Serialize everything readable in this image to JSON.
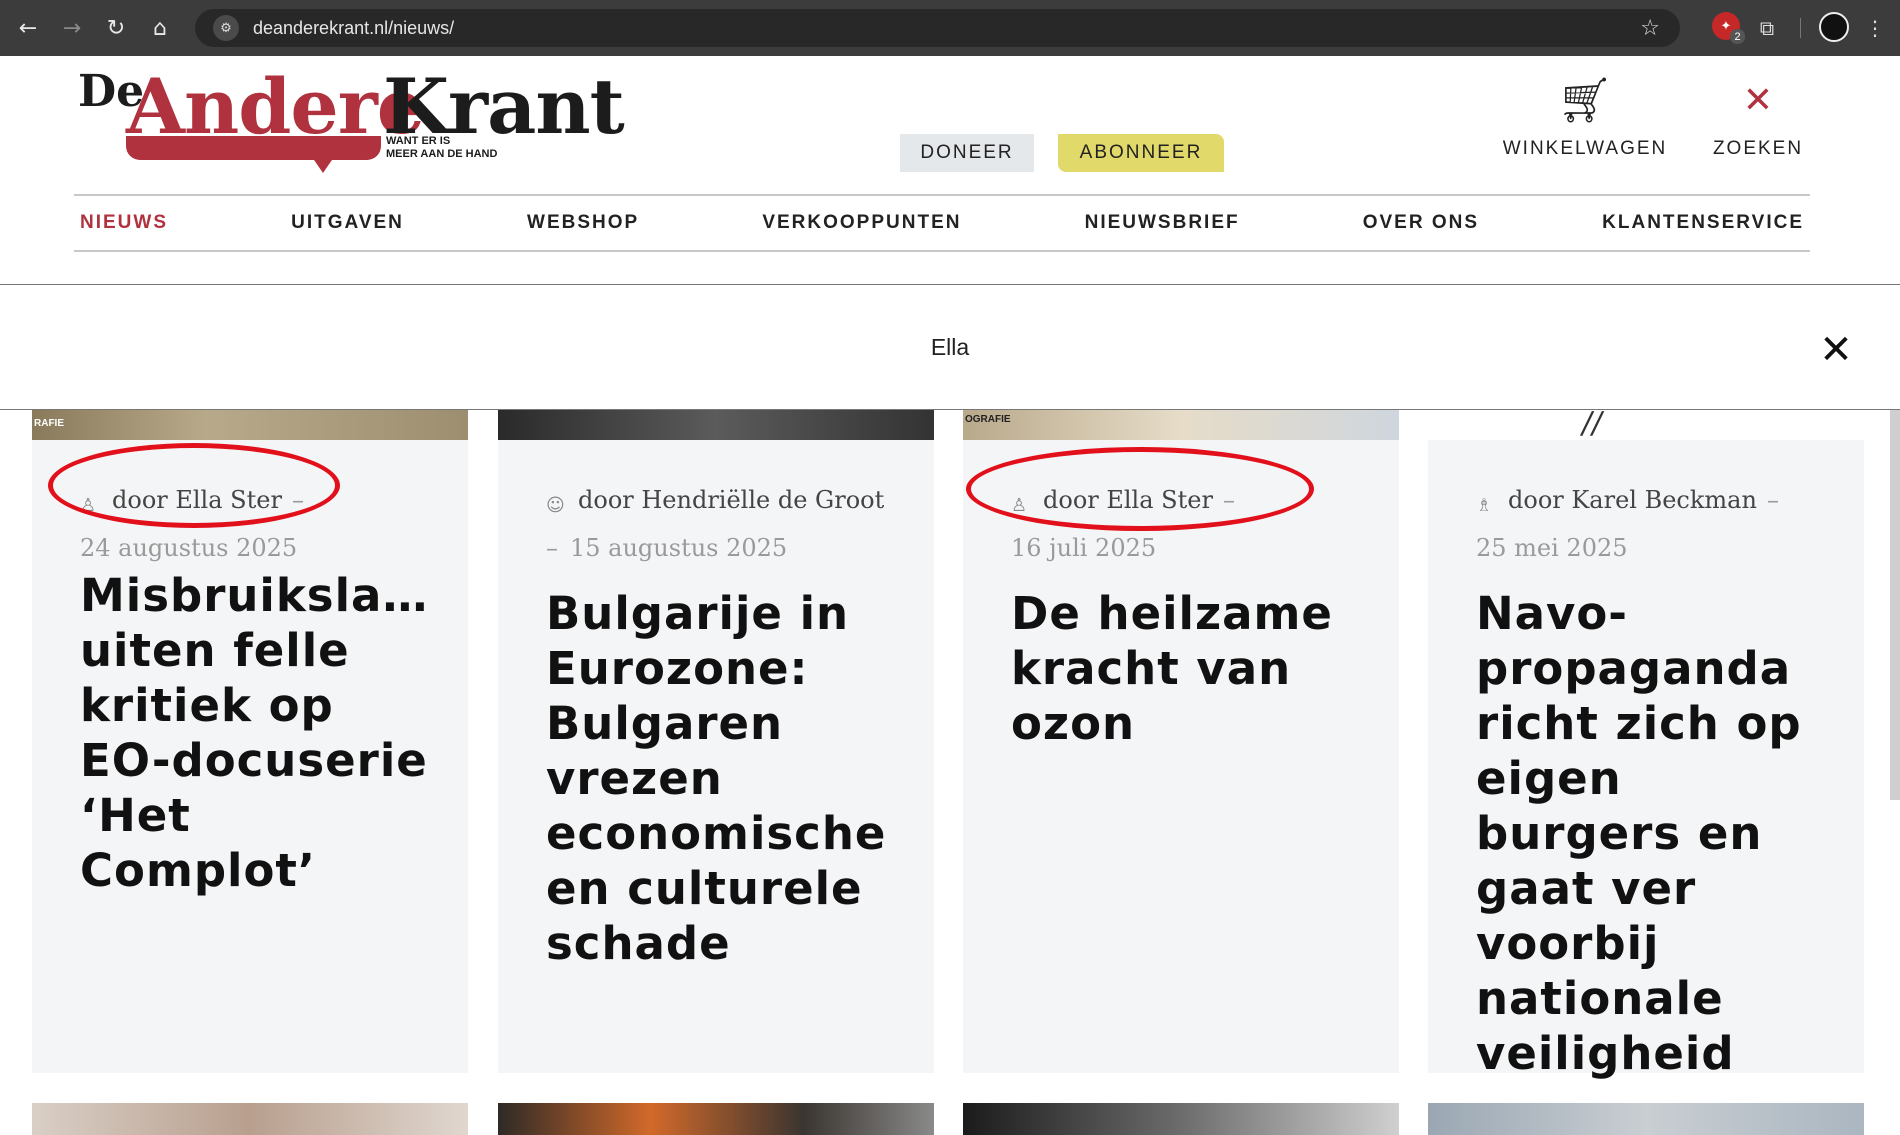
{
  "browser": {
    "back_icon": "back-arrow-icon",
    "forward_icon": "forward-arrow-icon",
    "reload_icon": "reload-icon",
    "home_icon": "home-icon",
    "url": "deanderekrant.nl/nieuws/",
    "bookmark_icon": "star-icon",
    "extension_badge_count": "2"
  },
  "header": {
    "logo": {
      "de": "De",
      "andere": "Andere",
      "krant": "Krant",
      "tagline_line1": "WANT ER IS",
      "tagline_line2": "MEER AAN DE HAND"
    },
    "doneer_label": "DONEER",
    "abonneer_label": "ABONNEER",
    "cart_label": "WINKELWAGEN",
    "search_label": "ZOEKEN"
  },
  "nav": {
    "items": [
      {
        "label": "NIEUWS",
        "active": true
      },
      {
        "label": "UITGAVEN"
      },
      {
        "label": "WEBSHOP"
      },
      {
        "label": "VERKOOPPUNTEN"
      },
      {
        "label": "NIEUWSBRIEF"
      },
      {
        "label": "OVER ONS"
      },
      {
        "label": "KLANTENSERVICE"
      }
    ]
  },
  "search": {
    "value": "Ella"
  },
  "articles": [
    {
      "author": "door Ella Ster",
      "date": "24 augustus 2025",
      "title": "Misbruiksla… uiten felle kritiek op EO-docuserie ‘Het Complot’",
      "highlighted": true
    },
    {
      "author": "door Hendriëlle de Groot",
      "date": "15 augustus 2025",
      "title": "Bulgarije in Eurozone: Bulgaren vrezen economische en culturele schade",
      "highlighted": false
    },
    {
      "author": "door Ella Ster",
      "date": "16 juli 2025",
      "title": "De heilzame kracht van ozon",
      "highlighted": true
    },
    {
      "author": "door Karel Beckman",
      "date": "25 mei 2025",
      "title": "Navo-propaganda richt zich op eigen burgers en gaat ver voorbij nationale veiligheid",
      "highlighted": false
    }
  ],
  "image_captions": [
    "RAFIE",
    "OGRAFIE"
  ],
  "colors": {
    "brand_red": "#b0323f",
    "abonneer_yellow": "#e1d969",
    "highlight_red": "#e1101a",
    "card_bg": "#f4f5f7"
  }
}
